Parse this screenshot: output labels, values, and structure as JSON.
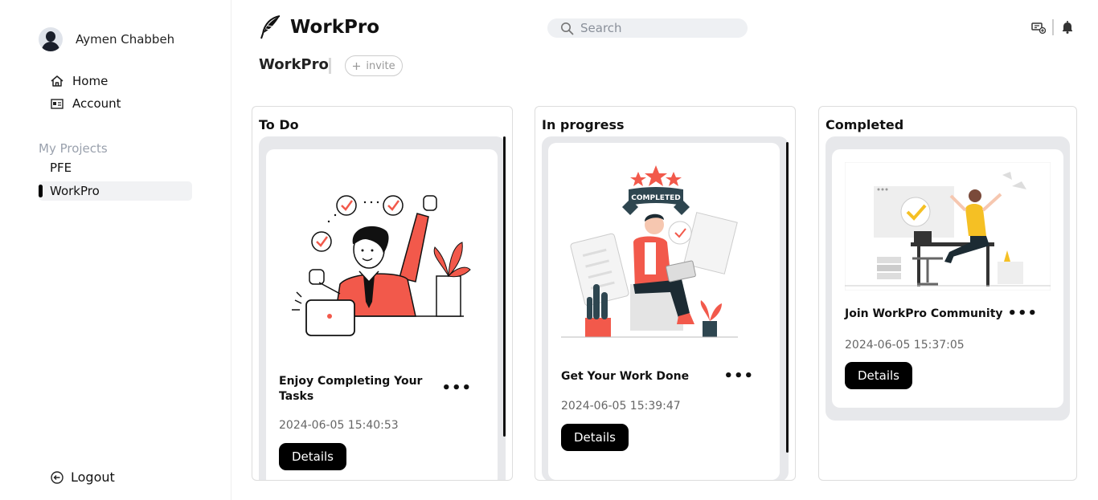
{
  "sidebar": {
    "user_name": "Aymen Chabbeh",
    "nav": [
      {
        "label": "Home",
        "icon": "home-icon"
      },
      {
        "label": "Account",
        "icon": "account-card-icon"
      }
    ],
    "projects_label": "My Projects",
    "projects": [
      {
        "label": "PFE",
        "active": false
      },
      {
        "label": "WorkPro",
        "active": true
      }
    ],
    "logout_label": "Logout"
  },
  "header": {
    "brand": "WorkPro",
    "search_placeholder": "Search",
    "icons": [
      "add-board-icon",
      "bell-icon"
    ]
  },
  "workspace": {
    "title": "WorkPro",
    "invite_label": "invite"
  },
  "columns": [
    {
      "title": "To Do",
      "cards": [
        {
          "title": "Enjoy Completing Your Tasks",
          "date": "2024-06-05 15:40:53",
          "button": "Details",
          "illustration": "celebrating-man-illustration"
        }
      ]
    },
    {
      "title": "In progress",
      "cards": [
        {
          "title": "Get Your Work Done",
          "date": "2024-06-05 15:39:47",
          "button": "Details",
          "illustration": "completed-work-illustration",
          "banner_text": "COMPLETED"
        }
      ]
    },
    {
      "title": "Completed",
      "cards": [
        {
          "title": "Join WorkPro Community",
          "date": "2024-06-05 15:37:05",
          "button": "Details",
          "illustration": "community-illustration"
        }
      ]
    }
  ],
  "colors": {
    "accent": "#f2594b",
    "button": "#000000",
    "column_bg": "#e7e8eb"
  }
}
